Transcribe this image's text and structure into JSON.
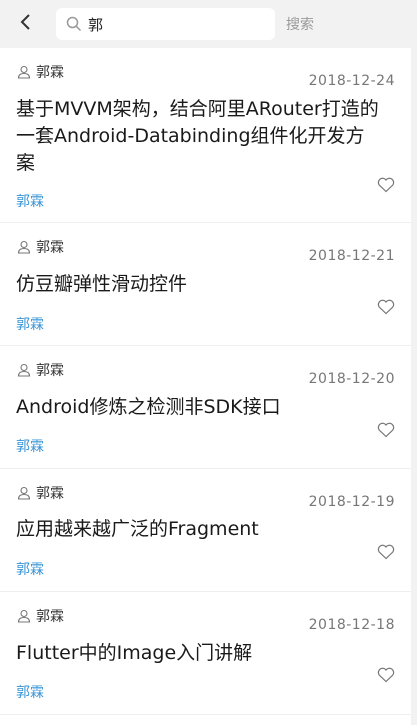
{
  "search": {
    "value": "郭",
    "button_label": "搜索"
  },
  "articles": [
    {
      "author": "郭霖",
      "date": "2018-12-24",
      "title": "基于MVVM架构，结合阿里ARouter打造的一套Android-Databinding组件化开发方案",
      "tag": "郭霖"
    },
    {
      "author": "郭霖",
      "date": "2018-12-21",
      "title": "仿豆瓣弹性滑动控件",
      "tag": "郭霖"
    },
    {
      "author": "郭霖",
      "date": "2018-12-20",
      "title": "Android修炼之检测非SDK接口",
      "tag": "郭霖"
    },
    {
      "author": "郭霖",
      "date": "2018-12-19",
      "title": "应用越来越广泛的Fragment",
      "tag": "郭霖"
    },
    {
      "author": "郭霖",
      "date": "2018-12-18",
      "title": "Flutter中的Image入门讲解",
      "tag": "郭霖"
    }
  ],
  "icons": {
    "back": "chevron-left-icon",
    "search": "search-icon",
    "author": "user-icon",
    "like": "heart-icon"
  },
  "colors": {
    "tag": "#3a94d6",
    "background": "#f2f2f2"
  }
}
